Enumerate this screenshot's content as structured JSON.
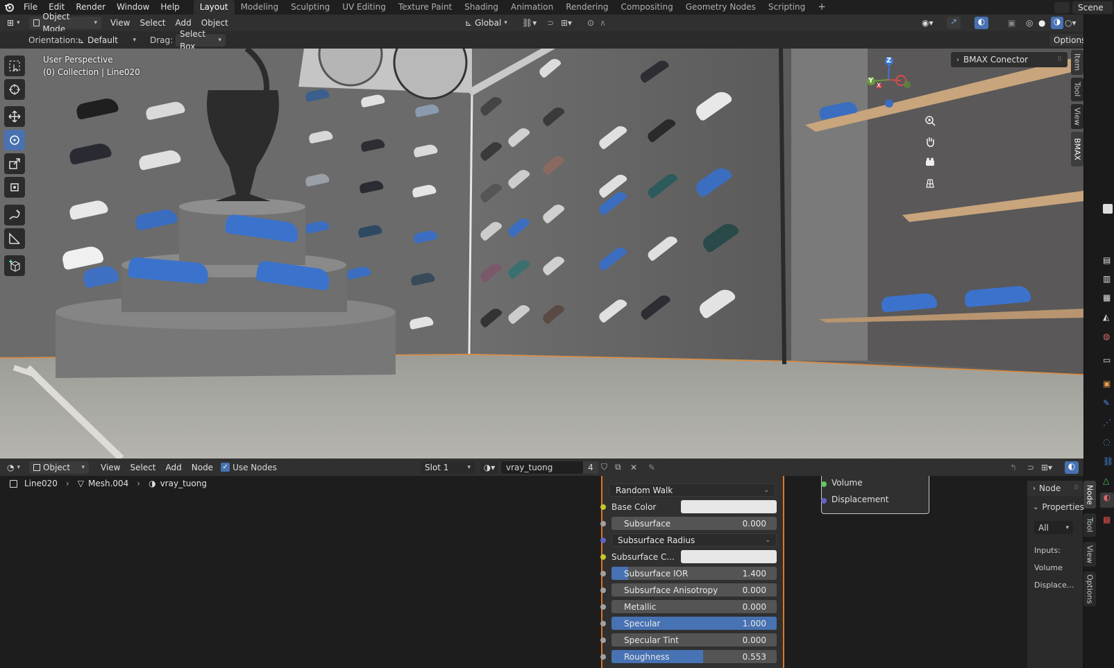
{
  "topbar": {
    "menus": [
      "File",
      "Edit",
      "Render",
      "Window",
      "Help"
    ],
    "workspaces": [
      "Layout",
      "Modeling",
      "Sculpting",
      "UV Editing",
      "Texture Paint",
      "Shading",
      "Animation",
      "Rendering",
      "Compositing",
      "Geometry Nodes",
      "Scripting"
    ],
    "active_workspace": "Layout",
    "add_tab": "+",
    "scene": "Scene"
  },
  "viewport_header": {
    "mode": "Object Mode",
    "menus": [
      "View",
      "Select",
      "Add",
      "Object"
    ],
    "transform_orientation": "Global"
  },
  "tool_settings": {
    "orientation_label": "Orientation:",
    "orientation_value": "Default",
    "drag_label": "Drag:",
    "drag_value": "Select Box",
    "options": "Options"
  },
  "viewport": {
    "perspective": "User Perspective",
    "collection": "(0) Collection | Line020",
    "gizmo": {
      "x": "X",
      "y": "Y",
      "z": "Z"
    },
    "bmax_panel": "BMAX Conector",
    "side_tabs": [
      "Item",
      "Tool",
      "View",
      "BMAX"
    ]
  },
  "node_header": {
    "editor": "Object",
    "menus": [
      "View",
      "Select",
      "Add",
      "Node"
    ],
    "use_nodes": "Use Nodes",
    "slot": "Slot 1",
    "material": "vray_tuong",
    "users": "4"
  },
  "breadcrumb": {
    "object": "Line020",
    "mesh": "Mesh.004",
    "material": "vray_tuong"
  },
  "bsdf": {
    "subsurface_method": "Random Walk",
    "base_color_label": "Base Color",
    "subsurface": {
      "label": "Subsurface",
      "value": "0.000",
      "fraction": 0
    },
    "subsurface_radius": "Subsurface Radius",
    "subsurface_color_label": "Subsurface C...",
    "subsurface_ior": {
      "label": "Subsurface IOR",
      "value": "1.400",
      "fraction": 0.1
    },
    "subsurface_anisotropy": {
      "label": "Subsurface Anisotropy",
      "value": "0.000",
      "fraction": 0
    },
    "metallic": {
      "label": "Metallic",
      "value": "0.000",
      "fraction": 0
    },
    "specular": {
      "label": "Specular",
      "value": "1.000",
      "fraction": 1
    },
    "specular_tint": {
      "label": "Specular Tint",
      "value": "0.000",
      "fraction": 0
    },
    "roughness": {
      "label": "Roughness",
      "value": "0.553",
      "fraction": 0.553
    }
  },
  "output_node": {
    "volume": "Volume",
    "displacement": "Displacement"
  },
  "node_sidebar": {
    "node": "Node",
    "properties": "Properties",
    "filter": "All",
    "inputs_label": "Inputs:",
    "inputs": [
      "Volume",
      "Displace..."
    ],
    "tabs": [
      "Node",
      "Tool",
      "View",
      "Options"
    ]
  },
  "colors": {
    "accent": "#4772b3",
    "header_bg": "#303030",
    "panel_bg": "#1d1d1d",
    "socket_yellow": "#c7c729",
    "socket_gray": "#a1a1a1",
    "socket_purple": "#6363c7",
    "socket_green": "#63c763"
  }
}
